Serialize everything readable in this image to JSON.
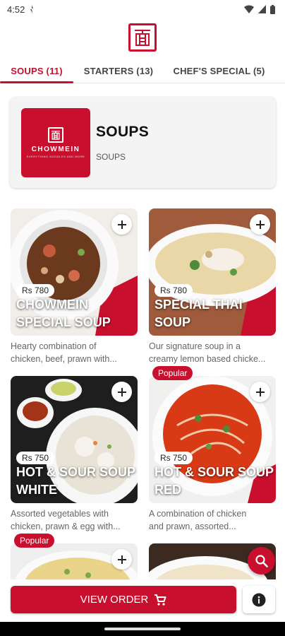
{
  "status_bar": {
    "time": "4:52"
  },
  "tabs": [
    {
      "label": "SOUPS (11)",
      "active": true
    },
    {
      "label": "STARTERS (13)",
      "active": false
    },
    {
      "label": "CHEF'S SPECIAL (5)",
      "active": false
    }
  ],
  "category": {
    "title": "SOUPS",
    "subtitle": "SOUPS",
    "thumb_brand": "CHOWMEIN",
    "thumb_brand_sub": "EVERYTHING NOODLES AND MORE"
  },
  "items": [
    {
      "name_line1": "CHOWMEIN",
      "name_line2": "SPECIAL SOUP",
      "price": "Rs 780",
      "desc1": "Hearty combination of",
      "desc2": "chicken, beef, prawn with...",
      "popular": false
    },
    {
      "name_line1": "SPECIAL THAI",
      "name_line2": "SOUP",
      "price": "Rs 780",
      "desc1": "Our signature soup in a",
      "desc2": "creamy lemon based chicke...",
      "popular": false
    },
    {
      "name_line1": "HOT & SOUR SOUP",
      "name_line2": "WHITE",
      "price": "Rs 750",
      "desc1": "Assorted vegetables with",
      "desc2": "chicken, prawn & egg with...",
      "popular": false
    },
    {
      "name_line1": "HOT & SOUR SOUP",
      "name_line2": "RED",
      "price": "Rs 750",
      "desc1": "A combination of chicken",
      "desc2": "and prawn, assorted...",
      "popular": true
    },
    {
      "popular": true
    }
  ],
  "popular_label": "Popular",
  "view_order_label": "VIEW ORDER",
  "colors": {
    "brand": "#c8102e",
    "text": "#222222",
    "muted": "#666666"
  },
  "icons": [
    "logo-icon",
    "add-icon",
    "search-icon",
    "cart-icon",
    "info-icon",
    "wifi-icon",
    "battery-icon",
    "signal-icon"
  ]
}
